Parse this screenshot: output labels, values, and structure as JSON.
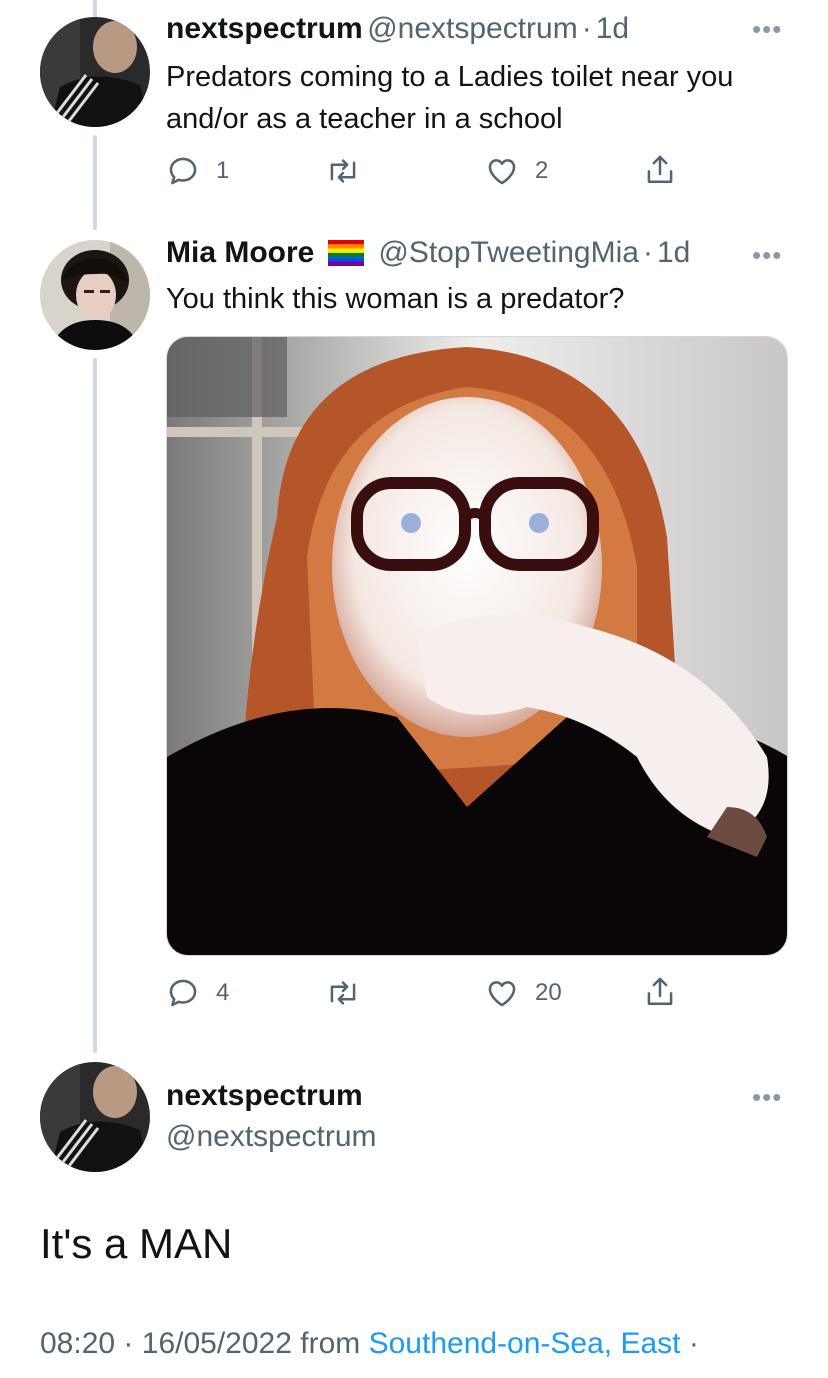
{
  "tweets": [
    {
      "name": "nextspectrum",
      "handle": "@nextspectrum",
      "time": "1d",
      "text": "Predators coming to a Ladies toilet near you and/or as a teacher in a school",
      "replies": "1",
      "likes": "2",
      "avatar_icon": "man-in-dark-jacket-avatar"
    },
    {
      "name": "Mia Moore",
      "flag_icon": "rainbow-flag-emoji",
      "handle": "@StopTweetingMia",
      "time": "1d",
      "text": "You think this woman is a predator?",
      "replies": "4",
      "likes": "20",
      "avatar_icon": "woman-dark-curly-hair-avatar",
      "media_icon": "red-haired-woman-with-glasses-photo"
    }
  ],
  "main_tweet": {
    "name": "nextspectrum",
    "handle": "@nextspectrum",
    "text": "It's a MAN",
    "time": "08:20",
    "date": "16/05/2022",
    "from_label": "from",
    "location": "Southend-on-Sea, East"
  },
  "separator": "·",
  "colors": {
    "link": "#1d9bf0",
    "secondary_text": "#536471",
    "thread_line": "#cfd9de"
  }
}
